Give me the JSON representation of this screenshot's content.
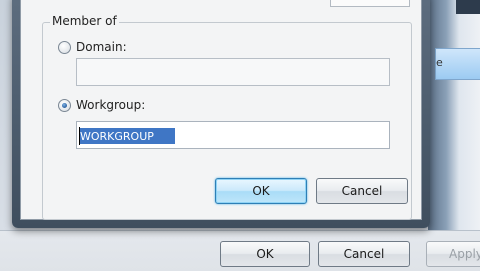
{
  "dialog": {
    "group_label": "Member of",
    "domain_option": {
      "label": "Domain:",
      "selected": false,
      "value": ""
    },
    "workgroup_option": {
      "label": "Workgroup:",
      "selected": true,
      "value": "WORKGROUP"
    },
    "ok_label": "OK",
    "cancel_label": "Cancel"
  },
  "parent_window": {
    "ok_label": "OK",
    "cancel_label": "Cancel",
    "apply_label": "Apply",
    "side_button_label": "e"
  },
  "colors": {
    "selection": "#3f76c5",
    "default_button": "#a9dcf7",
    "window_frame": "#4a5a6b"
  }
}
